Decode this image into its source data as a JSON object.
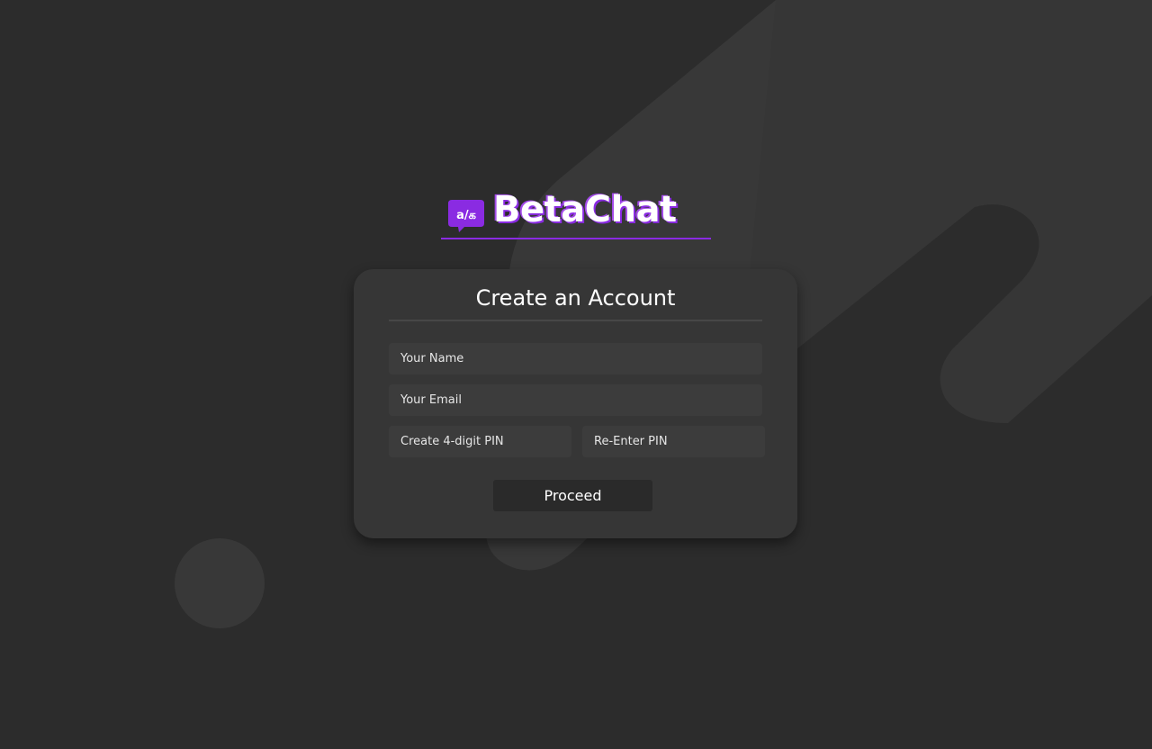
{
  "brand": {
    "name": "BetaChat",
    "icon_glyph": "a/க",
    "accent_color": "#8a2be2"
  },
  "form": {
    "title": "Create an Account",
    "name_placeholder": "Your Name",
    "email_placeholder": "Your Email",
    "pin_placeholder": "Create 4-digit PIN",
    "repin_placeholder": "Re-Enter PIN",
    "submit_label": "Proceed"
  },
  "colors": {
    "background": "#2c2c2c",
    "card": "#363636",
    "field": "#3c3c3c",
    "button": "#2a2a2a"
  }
}
